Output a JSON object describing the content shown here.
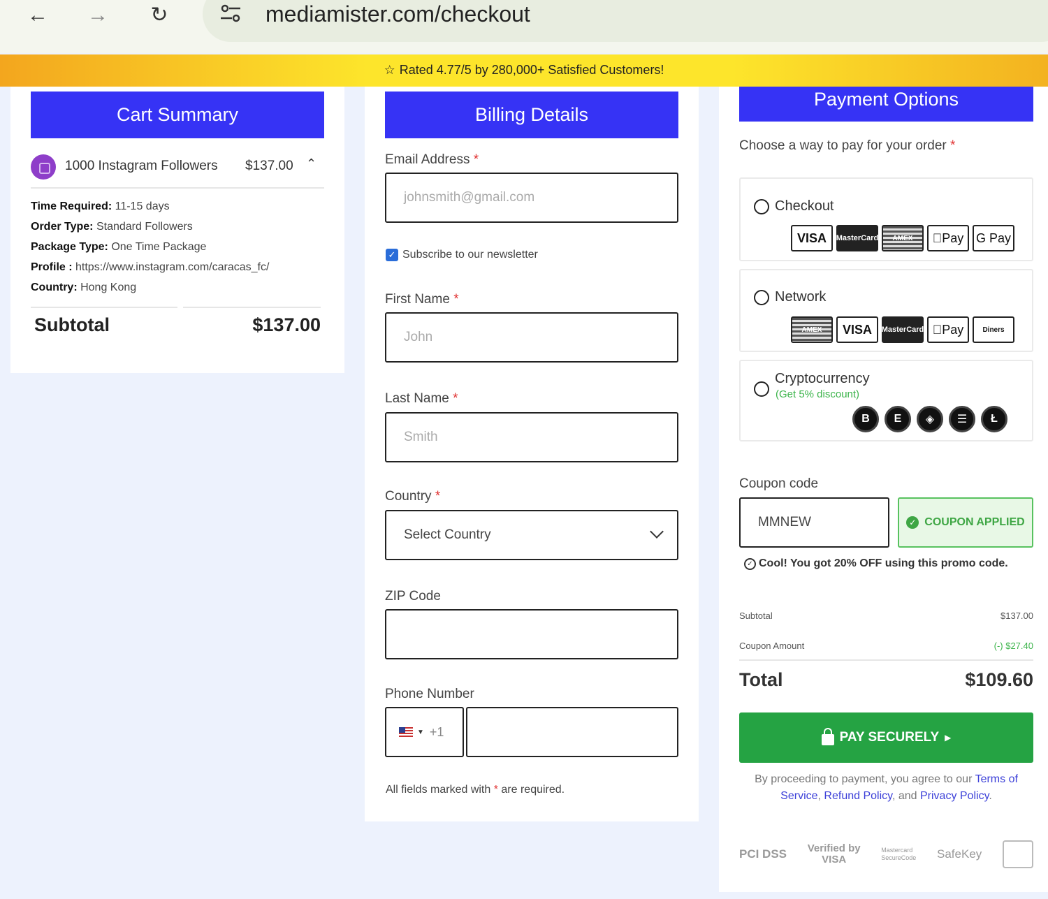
{
  "browser": {
    "url": "mediamister.com/checkout"
  },
  "banner": {
    "rating_text": "Rated 4.77/5 by 280,000+ Satisfied Customers!"
  },
  "cart": {
    "title": "Cart Summary",
    "item": {
      "name": "1000 Instagram Followers",
      "price": "$137.00"
    },
    "details": [
      {
        "label": "Time Required:",
        "value": " 11-15 days"
      },
      {
        "label": "Order Type:",
        "value": " Standard Followers"
      },
      {
        "label": "Package Type:",
        "value": " One Time Package"
      },
      {
        "label": "Profile :",
        "value": " https://www.instagram.com/caracas_fc/"
      },
      {
        "label": "Country:",
        "value": " Hong Kong"
      }
    ],
    "subtotal_label": "Subtotal",
    "subtotal_value": "$137.00"
  },
  "billing": {
    "title": "Billing Details",
    "email": {
      "label": "Email Address",
      "placeholder": "johnsmith@gmail.com"
    },
    "newsletter_label": "Subscribe to our newsletter",
    "first_name": {
      "label": "First Name",
      "placeholder": "John"
    },
    "last_name": {
      "label": "Last Name",
      "placeholder": "Smith"
    },
    "country": {
      "label": "Country",
      "selected": "Select Country"
    },
    "zip": {
      "label": "ZIP Code",
      "value": ""
    },
    "phone": {
      "label": "Phone Number",
      "dial_code": "+1",
      "value": ""
    },
    "required_note_before": "All fields marked with ",
    "required_mark": "*",
    "required_note_after": " are required."
  },
  "payment": {
    "title": "Payment Options",
    "intro": "Choose a way to pay for your order",
    "options": [
      {
        "label": "Checkout",
        "logos": [
          "VISA",
          "MasterCard",
          "AMEX",
          "Pay",
          "G Pay"
        ]
      },
      {
        "label": "Network",
        "logos": [
          "AMEX",
          "VISA",
          "MasterCard",
          "Pay",
          "Diners"
        ]
      },
      {
        "label": "Cryptocurrency",
        "sub": "(Get 5% discount)",
        "coins": [
          "B",
          "E",
          "◈",
          "☰",
          "Ł"
        ]
      }
    ],
    "coupon_label": "Coupon code",
    "coupon_value": "MMNEW",
    "coupon_applied": "COUPON APPLIED",
    "promo_note": "Cool! You got 20% OFF using this promo code.",
    "subtotal_label": "Subtotal",
    "subtotal_value": "$137.00",
    "coupon_amount_label": "Coupon Amount",
    "coupon_amount_value": "(-) $27.40",
    "total_label": "Total",
    "total_value": "$109.60",
    "pay_button": "PAY SECURELY",
    "terms_before": "By proceeding to payment, you agree to our ",
    "terms_link1": "Terms of Service",
    "terms_sep1": ", ",
    "terms_link2": "Refund Policy",
    "terms_sep2": ", and ",
    "terms_link3": "Privacy Policy",
    "terms_after": ".",
    "badges": {
      "pci": "PCI DSS",
      "visa_top": "Verified by",
      "visa_bottom": "VISA",
      "mc_top": "Mastercard",
      "mc_bottom": "SecureCode",
      "safekey": "SafeKey"
    }
  },
  "colors": {
    "brand_blue": "#3633f5",
    "pay_green": "#25a343",
    "coupon_green": "#3ea644",
    "required_red": "#e03030",
    "link_blue": "#3b3fd8"
  }
}
